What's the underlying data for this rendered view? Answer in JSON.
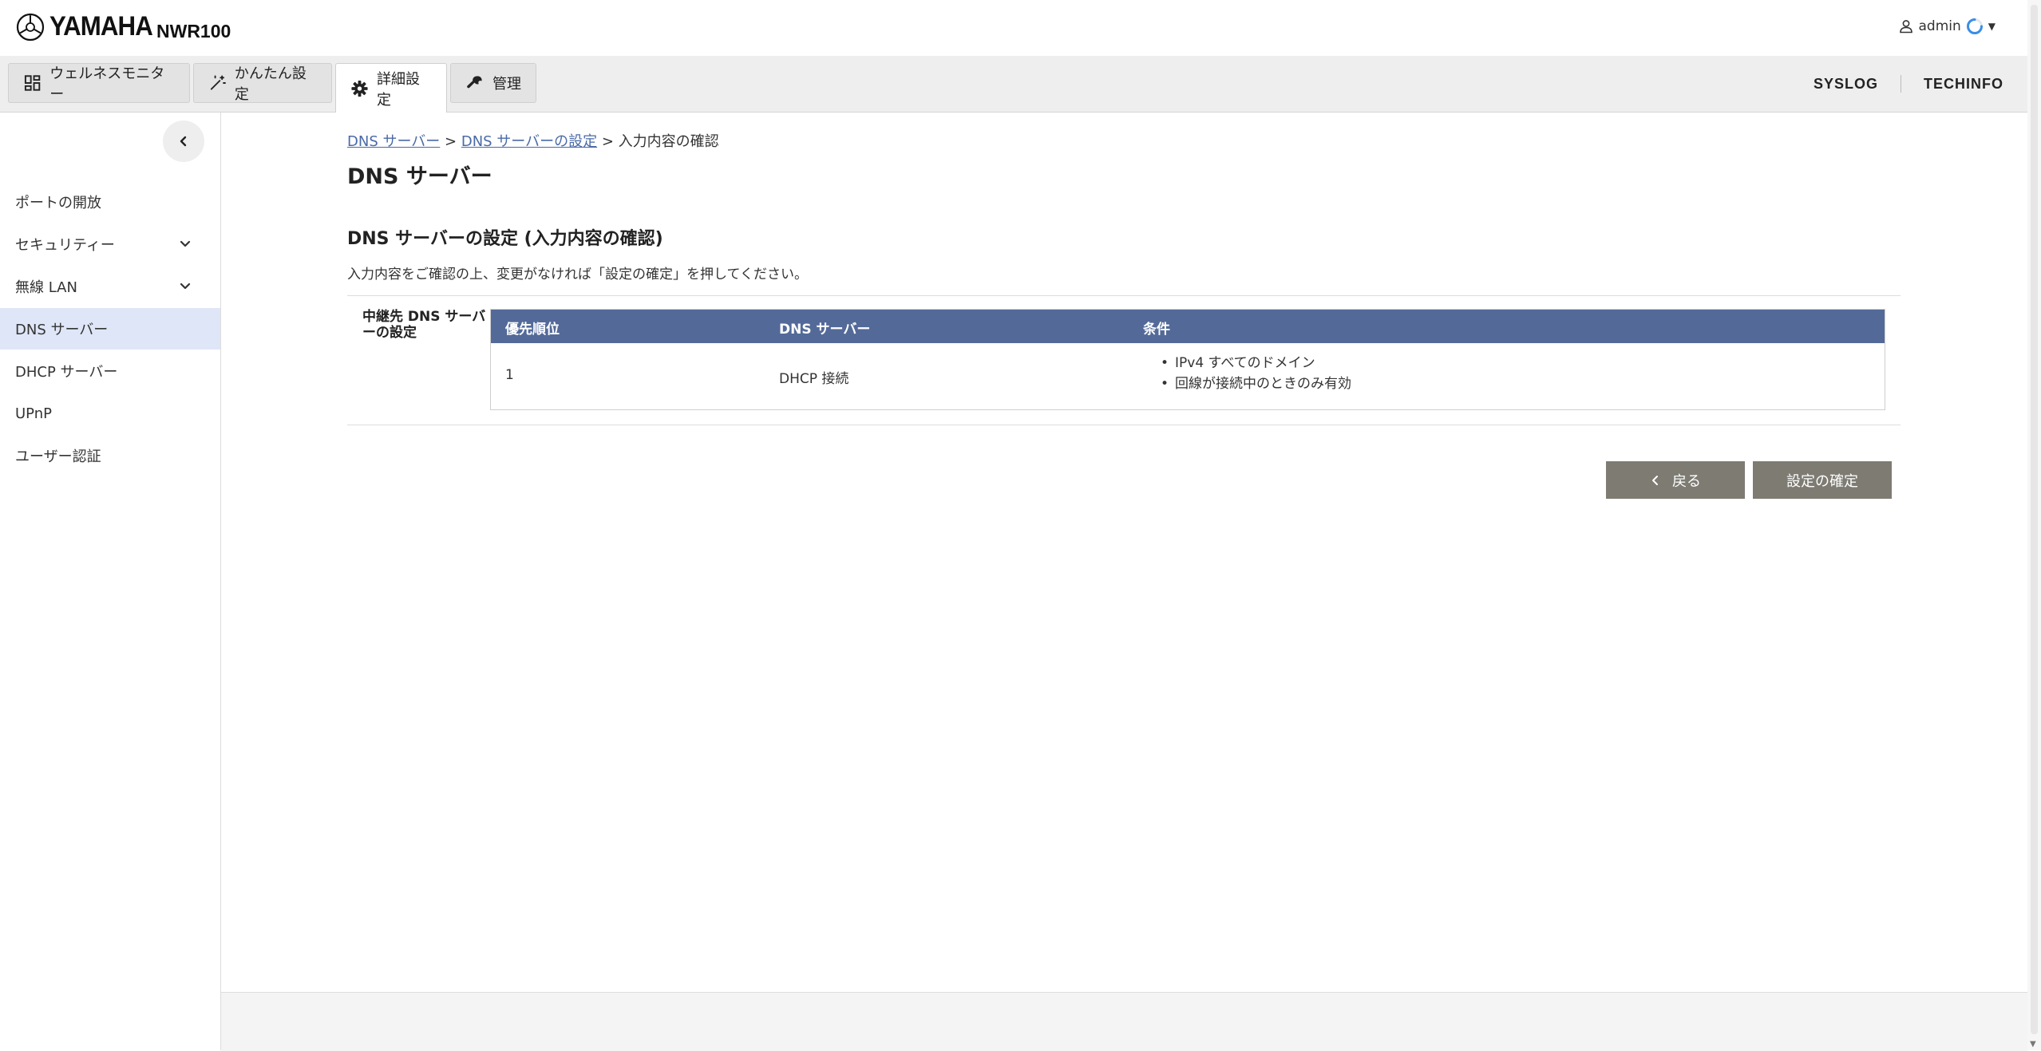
{
  "header": {
    "brand": "YAMAHA",
    "model": "NWR100",
    "user": "admin"
  },
  "tabs": [
    {
      "label": "ウェルネスモニター",
      "icon": "dashboard-icon"
    },
    {
      "label": "かんたん設定",
      "icon": "magic-wand-icon"
    },
    {
      "label": "詳細設定",
      "icon": "gear-icon",
      "active": true
    },
    {
      "label": "管理",
      "icon": "wrench-icon"
    }
  ],
  "top_links": [
    "SYSLOG",
    "TECHINFO"
  ],
  "sidebar": {
    "items": [
      {
        "label": "ポートの開放",
        "expandable": false
      },
      {
        "label": "セキュリティー",
        "expandable": true
      },
      {
        "label": "無線 LAN",
        "expandable": true
      },
      {
        "label": "DNS サーバー",
        "active": true
      },
      {
        "label": "DHCP サーバー"
      },
      {
        "label": "UPnP"
      },
      {
        "label": "ユーザー認証"
      }
    ]
  },
  "breadcrumb": {
    "link1": "DNS サーバー",
    "sep1": " > ",
    "link2": "DNS サーバーの設定",
    "sep2": " > ",
    "current": "入力内容の確認"
  },
  "page": {
    "title": "DNS サーバー",
    "section_title": "DNS サーバーの設定 (入力内容の確認)",
    "instruction": "入力内容をご確認の上、変更がなければ「設定の確定」を押してください。",
    "field_label": "中継先 DNS サーバーの設定"
  },
  "table": {
    "headers": [
      "優先順位",
      "DNS サーバー",
      "条件"
    ],
    "rows": [
      {
        "priority": "1",
        "server": "DHCP 接続",
        "conditions": [
          "IPv4 すべてのドメイン",
          "回線が接続中のときのみ有効"
        ]
      }
    ]
  },
  "buttons": {
    "back": "戻る",
    "confirm": "設定の確定"
  },
  "colors": {
    "table_header": "#536a99",
    "active_sidebar": "#dfe6f7",
    "button": "#7d7b72",
    "link": "#4a6aa8",
    "spinner": "#3a8ee6"
  }
}
